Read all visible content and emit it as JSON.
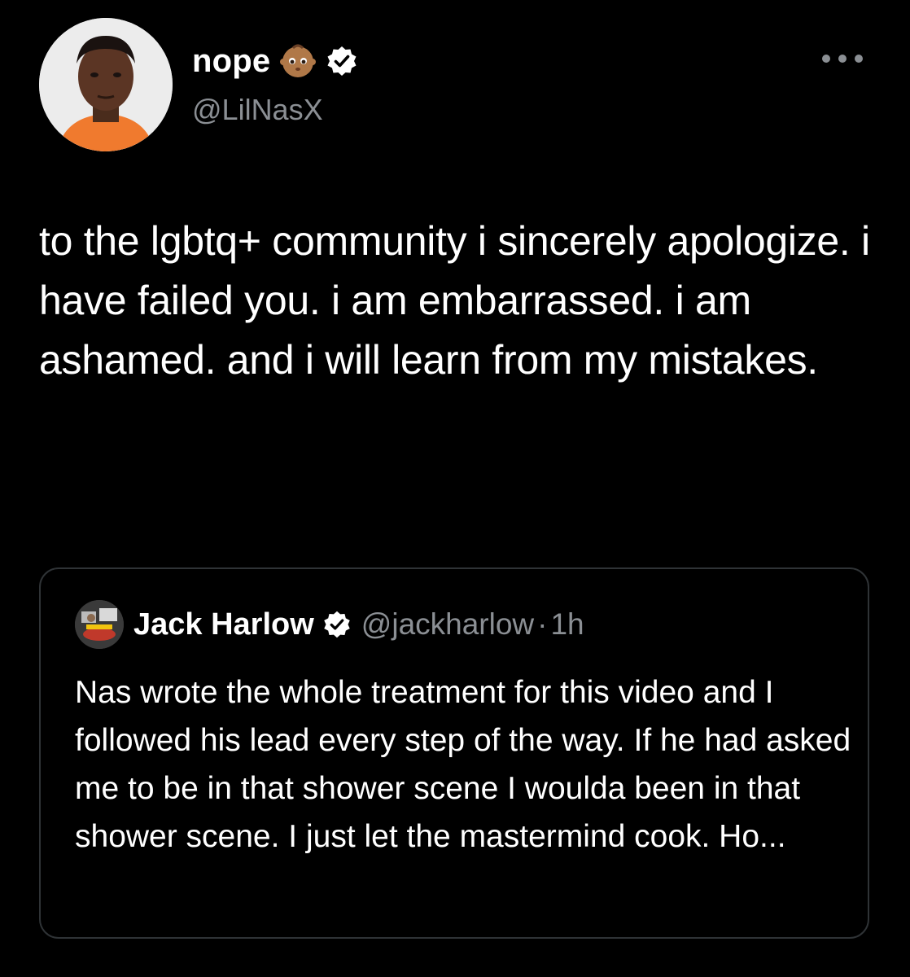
{
  "tweet": {
    "author": {
      "display_name": "nope",
      "handle": "@LilNasX",
      "name_emoji": "baby-face-emoji",
      "verified_icon": "verified-badge-icon"
    },
    "more_icon": "more-options-icon",
    "text": "to the lgbtq+ community i sincerely apologize. i have failed you. i am embarrassed. i am ashamed. and i will learn from my mistakes."
  },
  "quoted_tweet": {
    "author": {
      "display_name": "Jack Harlow",
      "handle": "@jackharlow",
      "verified_icon": "verified-badge-icon"
    },
    "separator": "·",
    "time": "1h",
    "text": "Nas wrote the whole treatment for this video and I followed his lead every step of the way. If he had asked me to be in that shower scene I woulda been in that shower scene. I just let the mastermind cook. Ho..."
  },
  "colors": {
    "background": "#000000",
    "text": "#ffffff",
    "secondary_text": "#8b8f94",
    "card_border": "#2f3336"
  }
}
